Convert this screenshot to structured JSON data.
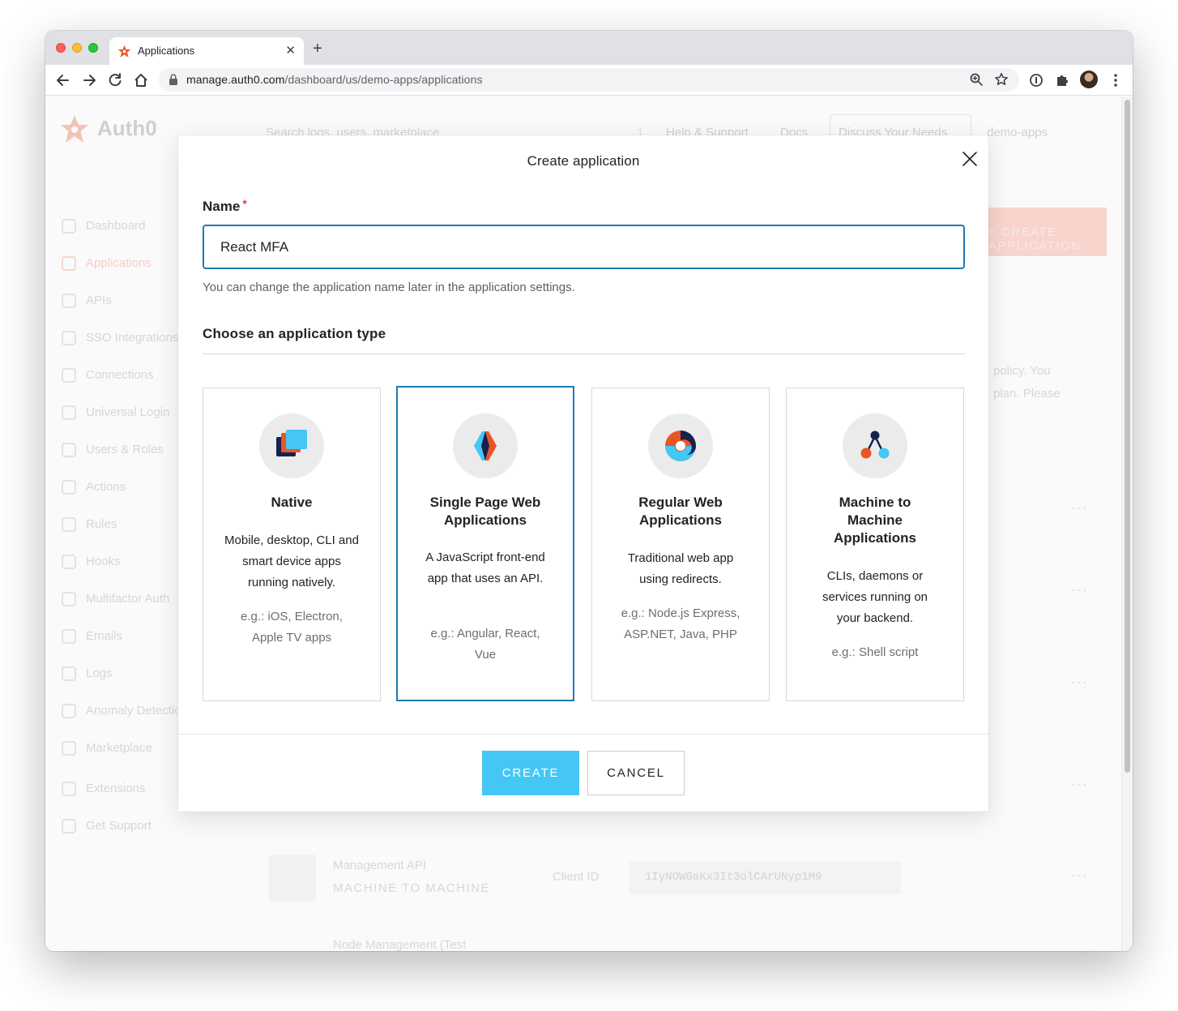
{
  "browser": {
    "tab_title": "Applications",
    "new_tab_glyph": "+",
    "url_host": "manage.auth0.com",
    "url_path": "/dashboard/us/demo-apps/applications"
  },
  "background": {
    "logo": "Auth0",
    "search_placeholder": "Search logs, users, marketplace",
    "notification_count": "1",
    "help": "Help & Support",
    "docs": "Docs",
    "discuss": "Discuss Your Needs",
    "tenant": "demo-apps",
    "create_button": "+ CREATE APPLICATION",
    "nav": [
      "Dashboard",
      "Applications",
      "APIs",
      "SSO Integrations",
      "Connections",
      "Universal Login",
      "Users & Roles",
      "Actions",
      "Rules",
      "Hooks",
      "Multifactor Auth",
      "Emails",
      "Logs",
      "Anomaly Detection",
      "Marketplace",
      "Extensions",
      "Get Support"
    ],
    "policy_line1": "policy. You",
    "policy_line2": "plan. Please",
    "row_name": "Management API",
    "row_type": "MACHINE TO MACHINE",
    "client_id_label": "Client ID",
    "client_id": "1IyNOWGaKx3It3olCArUNyp1M9",
    "row2_name": "Node Management (Test"
  },
  "modal": {
    "title": "Create application",
    "name_label": "Name",
    "required_mark": "*",
    "name_value": "React MFA",
    "help": "You can change the application name later in the application settings.",
    "section_title": "Choose an application type",
    "cards": [
      {
        "title": "Native",
        "description": "Mobile, desktop, CLI and smart device apps running natively.",
        "examples": "e.g.: iOS, Electron, Apple TV apps",
        "selected": false
      },
      {
        "title": "Single Page Web Applications",
        "description": "A JavaScript front-end app that uses an API.",
        "examples": "e.g.: Angular, React, Vue",
        "selected": true
      },
      {
        "title": "Regular Web Applications",
        "description": "Traditional web app using redirects.",
        "examples": "e.g.: Node.js Express, ASP.NET, Java, PHP",
        "selected": false
      },
      {
        "title": "Machine to Machine Applications",
        "description": "CLIs, daemons or services running on your backend.",
        "examples": "e.g.: Shell script",
        "selected": false
      }
    ],
    "create_label": "CREATE",
    "cancel_label": "CANCEL"
  },
  "colors": {
    "accent": "#1f7bb3",
    "create_button": "#44c7f4",
    "brand_red": "#eb5424"
  }
}
